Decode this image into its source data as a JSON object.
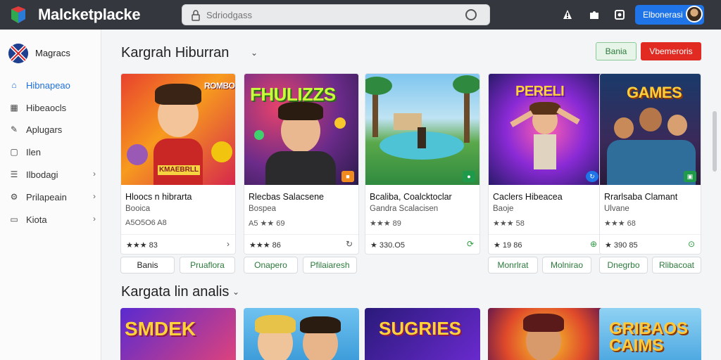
{
  "app": {
    "title": "Malcketplacke"
  },
  "search": {
    "placeholder": "Sdriodgass"
  },
  "header": {
    "signin_label": "Elbonerasi"
  },
  "sidebar": {
    "brand": "Magracs",
    "items": [
      {
        "label": "Hibnapeao",
        "icon": "home-icon",
        "active": true
      },
      {
        "label": "Hibeaocls",
        "icon": "calendar-icon"
      },
      {
        "label": "Aplugars",
        "icon": "puzzle-icon"
      },
      {
        "label": "Ilen",
        "icon": "square-icon"
      },
      {
        "label": "Ilbodagi",
        "icon": "list-icon",
        "chevron": true
      },
      {
        "label": "Prilapeain",
        "icon": "gear-icon",
        "chevron": true
      },
      {
        "label": "Kiota",
        "icon": "folder-icon",
        "chevron": true
      }
    ]
  },
  "section1": {
    "title": "Kargrah Hiburran",
    "btn_green": "Bania",
    "btn_red": "Vbemeroris",
    "cards": [
      {
        "thumb_text": "ROMBO",
        "title": "Hloocs n hibrarta",
        "subtitle": "Booica",
        "meta": "A5O5O6 A8",
        "rating": "★★★ 83",
        "action": "›"
      },
      {
        "thumb_text": "FHULIZZS",
        "title": "Rlecbas Salacsene",
        "subtitle": "Bospea",
        "meta": "A5 ★★ 69",
        "rating": "★★★ 86",
        "action": "↻"
      },
      {
        "thumb_text": "",
        "title": "Bcaliba, Coalcktoclar",
        "subtitle": "Gandra Scalacisen",
        "meta": "★★★ 89",
        "rating": "★ 330.O5",
        "action": "⟳"
      },
      {
        "thumb_text": "PERELI",
        "title": "Caclers Hibeacea",
        "subtitle": "Baoje",
        "meta": "★★★ 58",
        "rating": "★ 19 86",
        "action": "⊕"
      },
      {
        "thumb_text": "GAMES",
        "title": "Rrarlsaba Clamant",
        "subtitle": "Ulvane",
        "meta": "★★★ 68",
        "rating": "★ 390 85",
        "action": "⊙"
      }
    ],
    "pills": [
      "Banis",
      "Pruaflora",
      "Onapero",
      "Pfilaiaresh",
      "Monrlrat",
      "Molnirao",
      "Dnegrbo",
      "Rlibacoat"
    ]
  },
  "section2": {
    "title": "Kargata lin analis",
    "thumbs": [
      "SMDEK",
      "",
      "SUGRIES",
      "",
      "GRIBAOS CAIMS"
    ]
  },
  "colors": {
    "topbar": "#34373d",
    "accent": "#1f74e8",
    "danger": "#e02a22",
    "success": "#2a9a3e"
  }
}
